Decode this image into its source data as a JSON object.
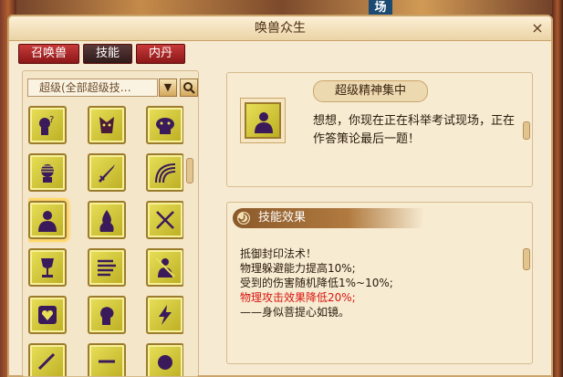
{
  "window": {
    "title": "唤兽众生",
    "close_label": "×"
  },
  "background": {
    "sign_text": "场"
  },
  "tabs": [
    {
      "label": "召唤兽",
      "active": false
    },
    {
      "label": "技能",
      "active": true
    },
    {
      "label": "内丹",
      "active": false
    }
  ],
  "filter": {
    "value": "超级(全部超级技…",
    "dropdown_icon": "▼"
  },
  "skills": [
    {
      "icon": "question-head-icon"
    },
    {
      "icon": "demon-face-icon"
    },
    {
      "icon": "dragon-head-icon"
    },
    {
      "icon": "feather-head-icon"
    },
    {
      "icon": "sword-icon"
    },
    {
      "icon": "rainbow-arc-icon"
    },
    {
      "icon": "silhouette-icon",
      "selected": true
    },
    {
      "icon": "flame-figure-icon"
    },
    {
      "icon": "crossed-swords-icon"
    },
    {
      "icon": "goblet-icon"
    },
    {
      "icon": "wind-lines-icon"
    },
    {
      "icon": "slashed-figure-icon"
    },
    {
      "icon": "heart-gem-icon"
    },
    {
      "icon": "head-profile-icon"
    },
    {
      "icon": "lightning-icon"
    },
    {
      "icon": "partial-icon-1"
    },
    {
      "icon": "partial-icon-2"
    },
    {
      "icon": "partial-icon-3"
    }
  ],
  "skill_detail": {
    "name": "超级精神集中",
    "description": "想想，你现在正在科举考试现场，正在作答策论最后一题！"
  },
  "effect": {
    "header": "技能效果",
    "lines": [
      {
        "text": "抵御封印法术！",
        "color": "normal"
      },
      {
        "text": "物理躲避能力提高10%;",
        "color": "normal"
      },
      {
        "text": "受到的伤害随机降低1%~10%;",
        "color": "normal"
      },
      {
        "text": "物理攻击效果降低20%;",
        "color": "red"
      },
      {
        "text": "——身似菩提心如镜。",
        "color": "normal"
      }
    ]
  }
}
